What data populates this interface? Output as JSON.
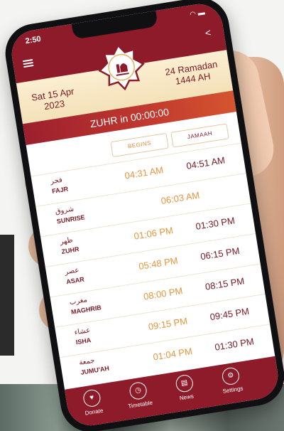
{
  "status": {
    "time": "2:50"
  },
  "dates": {
    "gregorian_line1": "Sat 15 Apr",
    "gregorian_line2": "2023",
    "hijri_line1": "24 Ramadan",
    "hijri_line2": "1444 AH"
  },
  "countdown": "ZUHR in 00:00:00",
  "columns": {
    "begins": "BEGINS",
    "jamaah": "JAMAAH"
  },
  "prayers": [
    {
      "arabic": "فجر",
      "name": "FAJR",
      "begins": "04:31 AM",
      "jamaah": "04:51 AM"
    },
    {
      "arabic": "شروق",
      "name": "SUNRISE",
      "single": "06:03 AM"
    },
    {
      "arabic": "ظهر",
      "name": "ZUHR",
      "begins": "01:06 PM",
      "jamaah": "01:30 PM"
    },
    {
      "arabic": "عصر",
      "name": "ASAR",
      "begins": "05:48 PM",
      "jamaah": "06:15 PM"
    },
    {
      "arabic": "مغرب",
      "name": "MAGHRIB",
      "begins": "08:00 PM",
      "jamaah": "08:15 PM"
    },
    {
      "arabic": "عشاء",
      "name": "ISHA",
      "begins": "09:15 PM",
      "jamaah": "09:45 PM"
    },
    {
      "arabic": "جمعة",
      "name": "JUMU'AH",
      "begins": "01:04 PM",
      "jamaah": "01:30 PM"
    }
  ],
  "nav": [
    {
      "label": "Donate",
      "icon": "donate-icon"
    },
    {
      "label": "Timetable",
      "icon": "timetable-icon"
    },
    {
      "label": "News",
      "icon": "news-icon"
    },
    {
      "label": "Settings",
      "icon": "settings-icon"
    }
  ],
  "colors": {
    "primary": "#8e1b2a",
    "accent": "#e5963e",
    "band": "#f3e1b8"
  }
}
